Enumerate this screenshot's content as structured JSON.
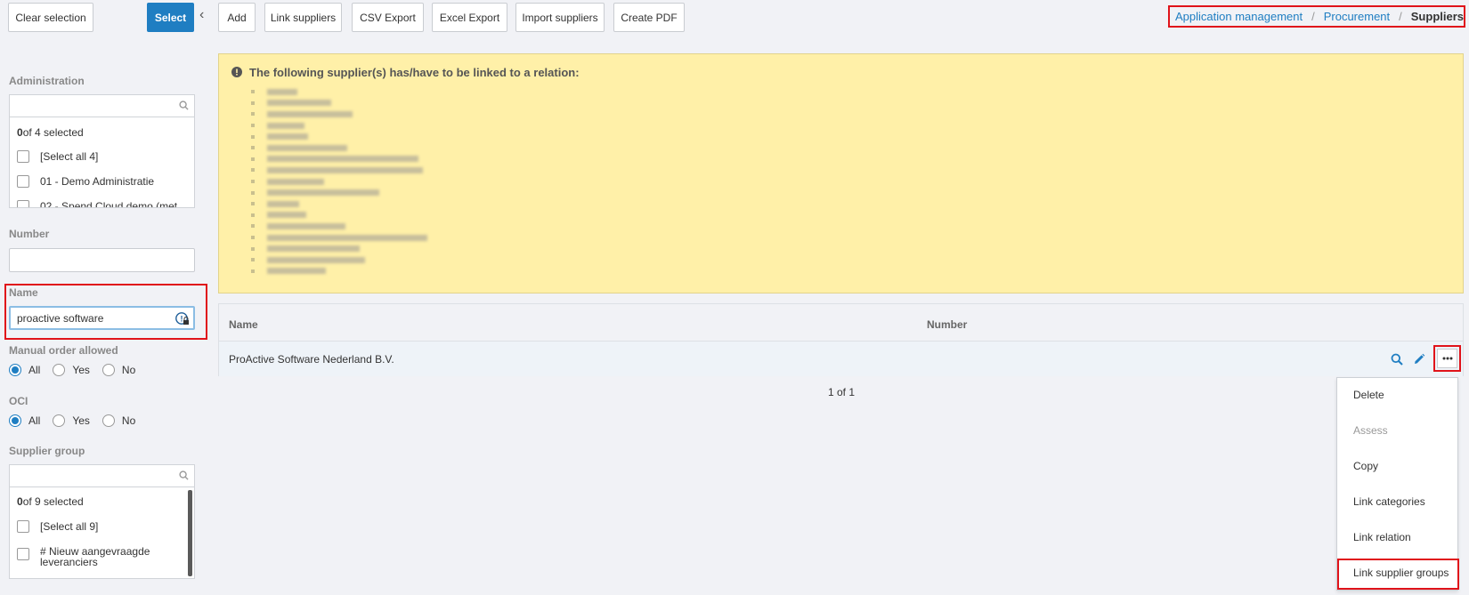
{
  "toolbar": {
    "clear_selection": "Clear selection",
    "select": "Select",
    "add": "Add",
    "link_suppliers": "Link suppliers",
    "csv_export": "CSV Export",
    "excel_export": "Excel Export",
    "import_suppliers": "Import suppliers",
    "create_pdf": "Create PDF"
  },
  "breadcrumb": {
    "items": [
      "Application management",
      "Procurement"
    ],
    "current": "Suppliers",
    "separator": "/"
  },
  "filters": {
    "administration": {
      "label": "Administration",
      "selected_count": "0",
      "selected_suffix": " of 4 selected",
      "options": [
        "[Select all 4]",
        "01 - Demo Administratie",
        "02 - Spend Cloud demo (met"
      ]
    },
    "number": {
      "label": "Number",
      "value": ""
    },
    "name": {
      "label": "Name",
      "value": "proactive software"
    },
    "manual_order": {
      "label": "Manual order allowed",
      "options": [
        "All",
        "Yes",
        "No"
      ],
      "selected": "All"
    },
    "oci": {
      "label": "OCI",
      "options": [
        "All",
        "Yes",
        "No"
      ],
      "selected": "All"
    },
    "supplier_group": {
      "label": "Supplier group",
      "selected_count": "0",
      "selected_suffix": " of 9 selected",
      "options": [
        "[Select all 9]",
        "# Nieuw aangevraagde leveranciers"
      ]
    }
  },
  "alert": {
    "title": "The following supplier(s) has/have to be linked to a relation:",
    "icon": "exclamation-circle-icon"
  },
  "table": {
    "columns": [
      "Name",
      "Number"
    ],
    "rows": [
      {
        "name": "ProActive Software Nederland B.V.",
        "number": ""
      }
    ]
  },
  "pagination": "1 of 1",
  "context_menu": {
    "items": [
      "Delete",
      "Assess",
      "Copy",
      "Link categories",
      "Link relation",
      "Link supplier groups"
    ],
    "disabled": [
      "Assess"
    ]
  },
  "colors": {
    "accent": "#1f7ec2",
    "highlight": "#e0131a",
    "alert_bg": "#fff0a8"
  }
}
